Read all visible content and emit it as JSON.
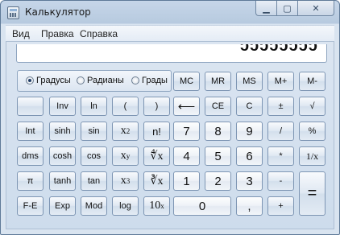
{
  "window": {
    "title": "Калькулятор",
    "min_glyph": "▁",
    "max_glyph": "▢",
    "close_glyph": "✕"
  },
  "menu": {
    "view": "Вид",
    "edit": "Правка",
    "help": "Справка"
  },
  "display": {
    "value": "ᴐᴐᴐᴐᴐᴐᴐᴐ"
  },
  "angle_mode": {
    "degrees": "Градусы",
    "radians": "Радианы",
    "grads": "Грады",
    "selected": "degrees"
  },
  "keys": {
    "mc": "MC",
    "mr": "MR",
    "ms": "MS",
    "mplus": "M+",
    "mminus": "M-",
    "blank": "",
    "inv": "Inv",
    "ln": "ln",
    "lparen": "(",
    "rparen": ")",
    "backspace": "⟵",
    "ce": "CE",
    "c": "C",
    "plusminus": "±",
    "sqrt": "√",
    "int": "Int",
    "sinh": "sinh",
    "sin": "sin",
    "x_base": "x",
    "sq_exp": "2",
    "fact": "n!",
    "seven": "7",
    "eight": "8",
    "nine": "9",
    "divide": "/",
    "percent": "%",
    "dms": "dms",
    "cosh": "cosh",
    "cos": "cos",
    "pow_exp": "y",
    "yroot": "∜x",
    "four": "4",
    "five": "5",
    "six": "6",
    "multiply": "*",
    "recip": "1/x",
    "pi": "π",
    "tanh": "tanh",
    "tan": "tan",
    "cube_exp": "3",
    "cuberoot": "∛x",
    "one": "1",
    "two": "2",
    "three": "3",
    "minus": "-",
    "equals": "=",
    "fe": "F-E",
    "exp": "Exp",
    "mod": "Mod",
    "log": "log",
    "ten_base": "10",
    "ten_exp": "x",
    "zero": "0",
    "decimal": ",",
    "plus": "+"
  }
}
